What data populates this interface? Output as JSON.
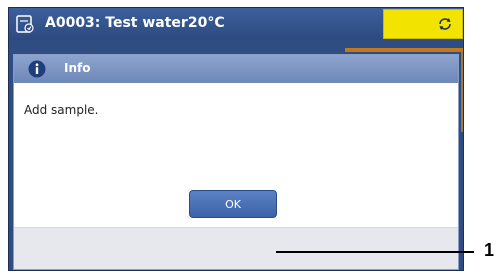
{
  "window": {
    "title": "A0003: Test water20°C",
    "title_icon": "method-doc-icon",
    "sync_icon": "refresh-icon",
    "status_color": "#f2e300"
  },
  "dialog": {
    "title": "Info",
    "icon": "info-icon",
    "message": "Add sample.",
    "ok_label": "OK"
  },
  "callout": {
    "label": "1"
  }
}
